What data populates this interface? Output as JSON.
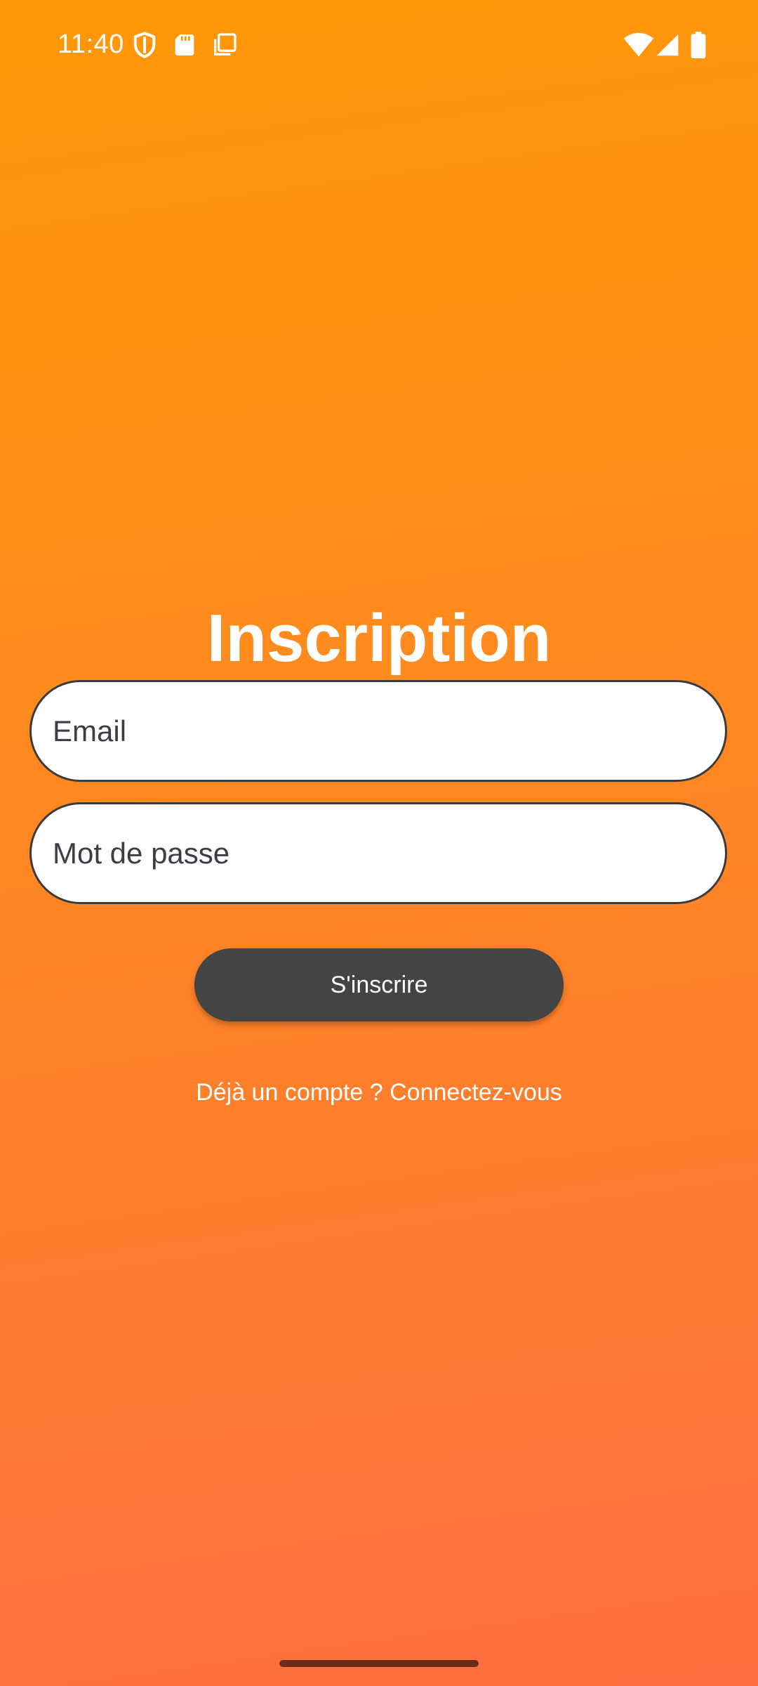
{
  "status_bar": {
    "time": "11:40",
    "left_icons": [
      "shield-icon",
      "sd-card-icon",
      "screenshot-icon"
    ],
    "right_icons": [
      "wifi-icon",
      "signal-icon",
      "battery-icon"
    ]
  },
  "page": {
    "title": "Inscription"
  },
  "form": {
    "email_placeholder": "Email",
    "password_placeholder": "Mot de passe",
    "submit_label": "S'inscrire"
  },
  "login_link": "Déjà un compte ? Connectez-vous",
  "colors": {
    "background_top": "#FF9807",
    "background_bottom": "#FF6E40",
    "button": "#444444",
    "field_border": "#3B3B3B"
  }
}
